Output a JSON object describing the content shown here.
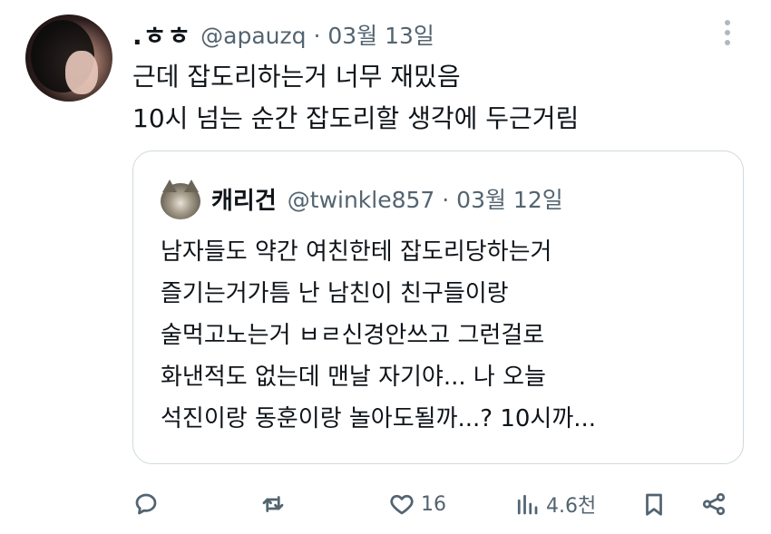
{
  "tweet": {
    "display_name": ".ㅎㅎ",
    "meta": "@apauzq · 03월 13일",
    "lines": [
      "근데 잡도리하는거 너무 재밌음",
      "10시 넘는 순간 잡도리할 생각에 두근거림"
    ]
  },
  "quote": {
    "display_name": "캐리건",
    "meta": "@twinkle857 · 03월 12일",
    "lines": [
      "남자들도 약간 여친한테 잡도리당하는거",
      "즐기는거가틈 난 남친이 친구들이랑",
      "술먹고노는거 ㅂㄹ신경안쓰고 그런걸로",
      "화낸적도 없는데 맨날 자기야... 나 오늘",
      "석진이랑 동훈이랑 놀아도될까...? 10시까..."
    ]
  },
  "actions": {
    "reply_icon": "reply-icon",
    "retweet_icon": "retweet-icon",
    "like_icon": "heart-icon",
    "like_count": "16",
    "views_icon": "views-icon",
    "views_count": "4.6천",
    "bookmark_icon": "bookmark-icon",
    "share_icon": "share-icon"
  },
  "colors": {
    "text": "#0f1419",
    "secondary": "#536471",
    "border": "#cfd9de"
  }
}
